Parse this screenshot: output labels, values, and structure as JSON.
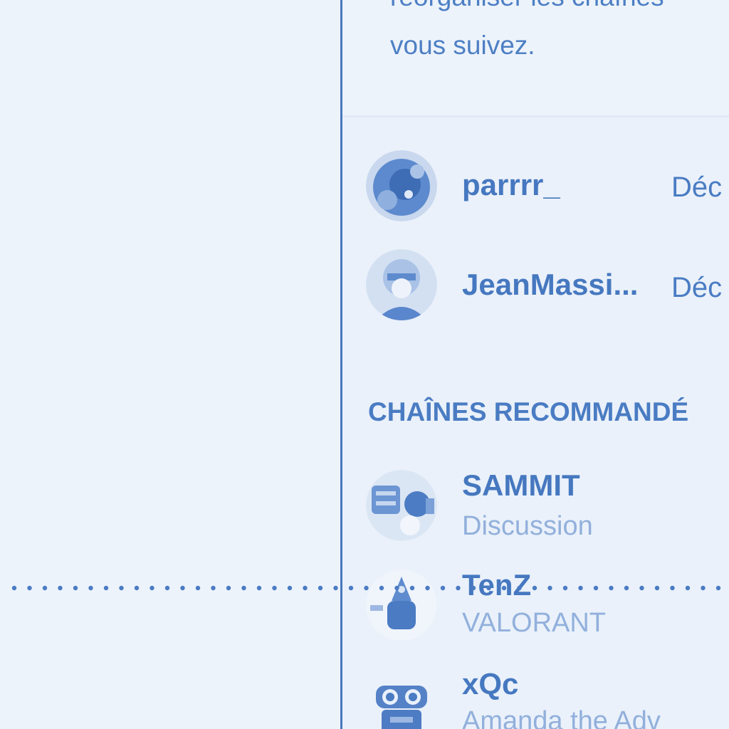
{
  "info": {
    "line1": "réorganiser les chaînes",
    "line2": "vous suivez."
  },
  "followed": [
    {
      "name": "parrrr_",
      "status": "Déc"
    },
    {
      "name": "JeanMassi...",
      "status": "Déc"
    }
  ],
  "recommended": {
    "heading": "CHAÎNES RECOMMANDÉ",
    "items": [
      {
        "name": "SAMMIT",
        "category": "Discussion"
      },
      {
        "name": "TenZ",
        "category": "VALORANT"
      },
      {
        "name": "xQc",
        "category": "Amanda the Adv"
      }
    ]
  },
  "colors": {
    "accent": "#4678c0",
    "muted": "#92b0dc",
    "background": "#ecf2fb",
    "divider": "#4a78bd"
  },
  "icons": {
    "xqc_avatar": "robot-icon"
  }
}
